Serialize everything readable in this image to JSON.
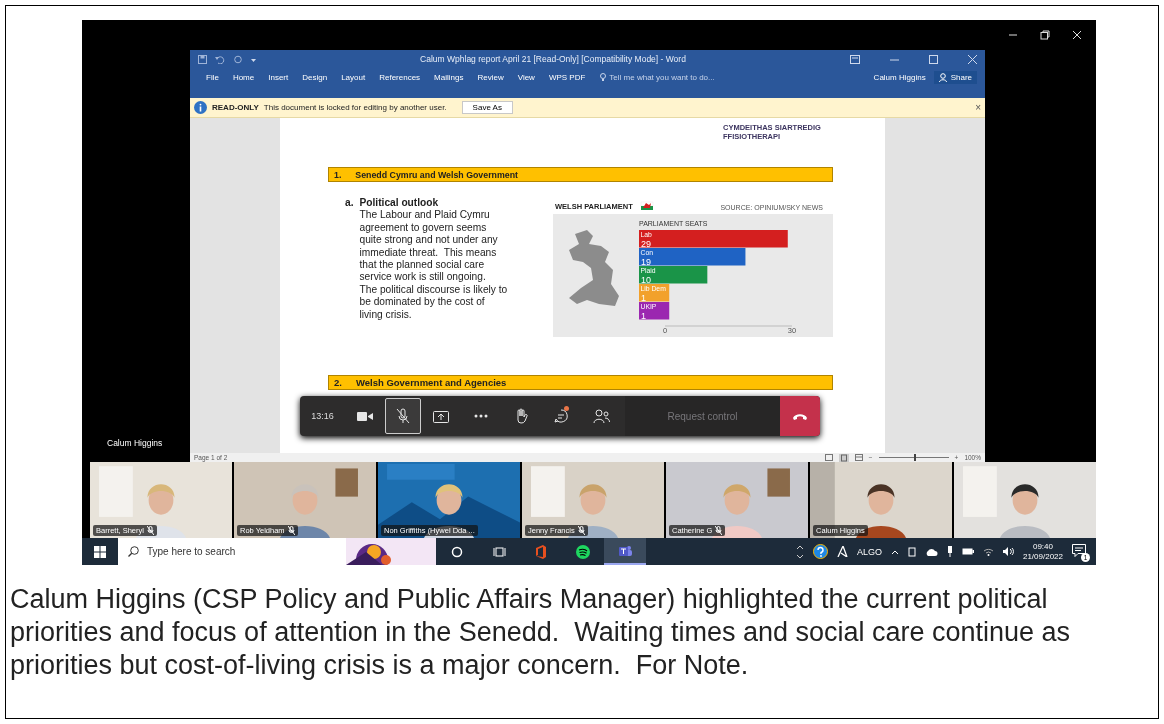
{
  "meeting_window": {
    "presenter_label": "Calum Higgins"
  },
  "word": {
    "title": "Calum Wphlag report April 21 [Read-Only] [Compatibility Mode] - Word",
    "ribbon_tabs": [
      {
        "label": "File"
      },
      {
        "label": "Home"
      },
      {
        "label": "Insert"
      },
      {
        "label": "Design"
      },
      {
        "label": "Layout"
      },
      {
        "label": "References"
      },
      {
        "label": "Mailings"
      },
      {
        "label": "Review"
      },
      {
        "label": "View"
      },
      {
        "label": "WPS PDF"
      }
    ],
    "tell_me": "Tell me what you want to do...",
    "user": "Calum Higgins",
    "share": "Share",
    "info_bar": {
      "label": "READ-ONLY",
      "message": "This document is locked for editing by another user.",
      "button": "Save As",
      "close": "×"
    },
    "document": {
      "org_name": [
        "CYMDEITHAS SIARTREDIG",
        "FFISIOTHERAPI"
      ],
      "heading_1": {
        "number": "1.",
        "title": "Senedd Cymru and Welsh Government"
      },
      "subsection": {
        "marker": "a.",
        "title": "Political outlook",
        "paragraphs": [
          "The Labour and Plaid Cymru agreement to govern seems quite strong and not under any immediate threat.  This means that the planned social care service work is still ongoing.",
          "The political discourse is likely to be dominated by the cost of living crisis."
        ]
      },
      "figure": {
        "title": "WELSH PARLIAMENT",
        "source": "SOURCE: OPINIUM/SKY NEWS",
        "chart_data": {
          "type": "bar",
          "orientation": "horizontal",
          "title": "PARLIAMENT SEATS",
          "categories": [
            "Lab",
            "Con",
            "Plaid",
            "Lib Dem",
            "UKIP"
          ],
          "series": [
            {
              "values": [
                29,
                19,
                10,
                1,
                1
              ]
            }
          ],
          "colors": [
            "#d41f1f",
            "#1f63c4",
            "#1a9448",
            "#f2a12b",
            "#9b27b0"
          ],
          "xlim": [
            0,
            30
          ],
          "xticks": [
            0,
            30
          ],
          "value_labels": [
            "29",
            "19",
            "10",
            "1",
            "1"
          ]
        }
      },
      "heading_2": {
        "number": "2.",
        "title": "Welsh Government and Agencies"
      }
    },
    "status_bar": {
      "page": "Page 1 of 2",
      "zoom_out": "−",
      "zoom_in": "+",
      "zoom": "100%",
      "zoom_slider": {
        "level": 0.5
      }
    }
  },
  "teams_bar": {
    "timer": "13:16",
    "mic_muted": true,
    "chat_unread": true,
    "request_control": {
      "label": "Request control",
      "disabled": true
    }
  },
  "participants": [
    {
      "name": "Barrett, Sheryl",
      "muted": true
    },
    {
      "name": "Rob Yeldham",
      "muted": true
    },
    {
      "name": "Non Griffiths (Hywel Dda ...",
      "muted": false
    },
    {
      "name": "Jenny Francis",
      "muted": true
    },
    {
      "name": "Catherine G",
      "muted": true
    },
    {
      "name": "Calum Higgins",
      "muted": false
    },
    {
      "muted": false
    }
  ],
  "taskbar": {
    "search_placeholder": "Type here to search",
    "apps": [
      {
        "kind": "cortana",
        "selected": false
      },
      {
        "kind": "taskview",
        "selected": false
      },
      {
        "kind": "office",
        "selected": false
      },
      {
        "kind": "spotify",
        "selected": false
      },
      {
        "kind": "teams",
        "selected": true
      }
    ],
    "tray_label": "ALGO",
    "time": "09:40",
    "date": "21/09/2022",
    "notifications": "1"
  },
  "caption": "Calum Higgins (CSP Policy and Public Affairs Manager) highlighted the current political priorities and focus of attention in the Senedd.  Waiting times and social care continue as priorities but cost-of-living crisis is a major concern.  For Note."
}
